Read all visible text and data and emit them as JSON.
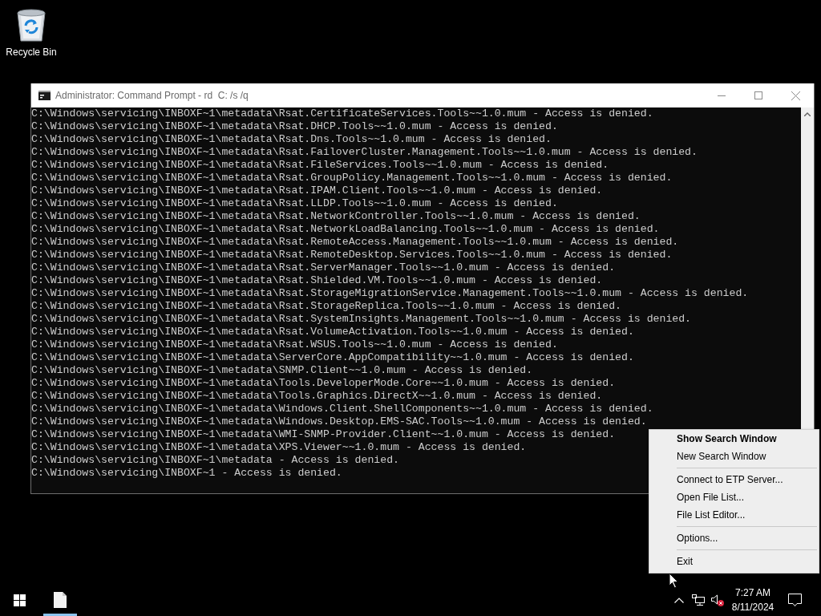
{
  "desktop_icons": [
    {
      "kind": "recycle-bin",
      "label": "Recycle Bin"
    }
  ],
  "window": {
    "title": "Administrator: Command Prompt - rd  C: /s /q",
    "lines": [
      "C:\\Windows\\servicing\\INBOXF~1\\metadata\\Rsat.CertificateServices.Tools~~1.0.mum - Access is denied.",
      "C:\\Windows\\servicing\\INBOXF~1\\metadata\\Rsat.DHCP.Tools~~1.0.mum - Access is denied.",
      "C:\\Windows\\servicing\\INBOXF~1\\metadata\\Rsat.Dns.Tools~~1.0.mum - Access is denied.",
      "C:\\Windows\\servicing\\INBOXF~1\\metadata\\Rsat.FailoverCluster.Management.Tools~~1.0.mum - Access is denied.",
      "C:\\Windows\\servicing\\INBOXF~1\\metadata\\Rsat.FileServices.Tools~~1.0.mum - Access is denied.",
      "C:\\Windows\\servicing\\INBOXF~1\\metadata\\Rsat.GroupPolicy.Management.Tools~~1.0.mum - Access is denied.",
      "C:\\Windows\\servicing\\INBOXF~1\\metadata\\Rsat.IPAM.Client.Tools~~1.0.mum - Access is denied.",
      "C:\\Windows\\servicing\\INBOXF~1\\metadata\\Rsat.LLDP.Tools~~1.0.mum - Access is denied.",
      "C:\\Windows\\servicing\\INBOXF~1\\metadata\\Rsat.NetworkController.Tools~~1.0.mum - Access is denied.",
      "C:\\Windows\\servicing\\INBOXF~1\\metadata\\Rsat.NetworkLoadBalancing.Tools~~1.0.mum - Access is denied.",
      "C:\\Windows\\servicing\\INBOXF~1\\metadata\\Rsat.RemoteAccess.Management.Tools~~1.0.mum - Access is denied.",
      "C:\\Windows\\servicing\\INBOXF~1\\metadata\\Rsat.RemoteDesktop.Services.Tools~~1.0.mum - Access is denied.",
      "C:\\Windows\\servicing\\INBOXF~1\\metadata\\Rsat.ServerManager.Tools~~1.0.mum - Access is denied.",
      "C:\\Windows\\servicing\\INBOXF~1\\metadata\\Rsat.Shielded.VM.Tools~~1.0.mum - Access is denied.",
      "C:\\Windows\\servicing\\INBOXF~1\\metadata\\Rsat.StorageMigrationService.Management.Tools~~1.0.mum - Access is denied.",
      "C:\\Windows\\servicing\\INBOXF~1\\metadata\\Rsat.StorageReplica.Tools~~1.0.mum - Access is denied.",
      "C:\\Windows\\servicing\\INBOXF~1\\metadata\\Rsat.SystemInsights.Management.Tools~~1.0.mum - Access is denied.",
      "C:\\Windows\\servicing\\INBOXF~1\\metadata\\Rsat.VolumeActivation.Tools~~1.0.mum - Access is denied.",
      "C:\\Windows\\servicing\\INBOXF~1\\metadata\\Rsat.WSUS.Tools~~1.0.mum - Access is denied.",
      "C:\\Windows\\servicing\\INBOXF~1\\metadata\\ServerCore.AppCompatibility~~1.0.mum - Access is denied.",
      "C:\\Windows\\servicing\\INBOXF~1\\metadata\\SNMP.Client~~1.0.mum - Access is denied.",
      "C:\\Windows\\servicing\\INBOXF~1\\metadata\\Tools.DeveloperMode.Core~~1.0.mum - Access is denied.",
      "C:\\Windows\\servicing\\INBOXF~1\\metadata\\Tools.Graphics.DirectX~~1.0.mum - Access is denied.",
      "C:\\Windows\\servicing\\INBOXF~1\\metadata\\Windows.Client.ShellComponents~~1.0.mum - Access is denied.",
      "C:\\Windows\\servicing\\INBOXF~1\\metadata\\Windows.Desktop.EMS-SAC.Tools~~1.0.mum - Access is denied.",
      "C:\\Windows\\servicing\\INBOXF~1\\metadata\\WMI-SNMP-Provider.Client~~1.0.mum - Access is denied.",
      "C:\\Windows\\servicing\\INBOXF~1\\metadata\\XPS.Viewer~~1.0.mum - Access is denied.",
      "C:\\Windows\\servicing\\INBOXF~1\\metadata - Access is denied.",
      "C:\\Windows\\servicing\\INBOXF~1 - Access is denied."
    ]
  },
  "context_menu": {
    "items": [
      {
        "kind": "item",
        "label": "Show Search Window",
        "default": true
      },
      {
        "kind": "item",
        "label": "New Search Window",
        "default": false
      },
      {
        "kind": "separator"
      },
      {
        "kind": "item",
        "label": "Connect to ETP Server...",
        "default": false
      },
      {
        "kind": "item",
        "label": "Open File List...",
        "default": false
      },
      {
        "kind": "item",
        "label": "File List Editor...",
        "default": false
      },
      {
        "kind": "separator"
      },
      {
        "kind": "item",
        "label": "Options...",
        "default": false
      },
      {
        "kind": "separator"
      },
      {
        "kind": "item",
        "label": "Exit",
        "default": false
      }
    ]
  },
  "taskbar": {
    "apps": [
      {
        "kind": "document",
        "running": true
      }
    ],
    "tray": {
      "volume_muted": true
    },
    "time": "7:27 AM",
    "date": "8/11/2024"
  }
}
